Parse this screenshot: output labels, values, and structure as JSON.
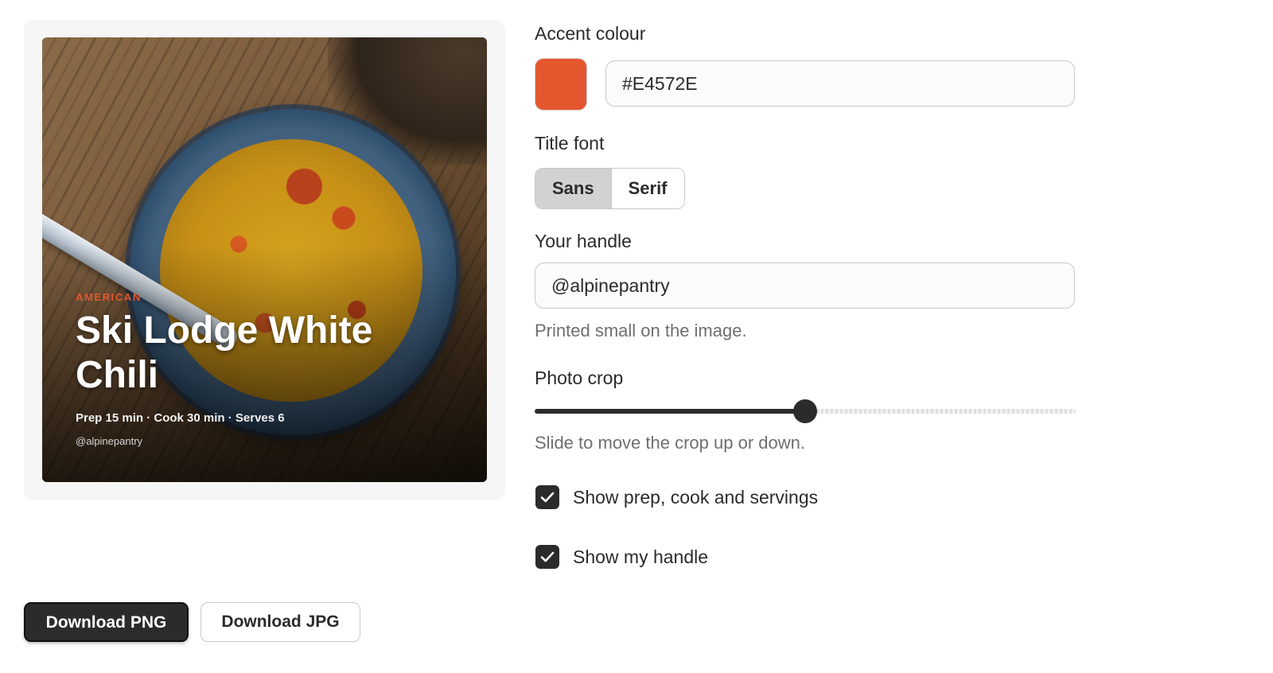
{
  "preview": {
    "category": "AMERICAN",
    "title": "Ski Lodge White Chili",
    "meta": "Prep 15 min · Cook 30 min · Serves 6",
    "handle": "@alpinepantry"
  },
  "accent": {
    "label": "Accent colour",
    "value": "#E4572E"
  },
  "title_font": {
    "label": "Title font",
    "options": [
      "Sans",
      "Serif"
    ],
    "selected": "Sans"
  },
  "handle_field": {
    "label": "Your handle",
    "value": "@alpinepantry",
    "hint": "Printed small on the image."
  },
  "photo_crop": {
    "label": "Photo crop",
    "value_fraction": 0.5,
    "hint": "Slide to move the crop up or down."
  },
  "options": {
    "show_meta": {
      "label": "Show prep, cook and servings",
      "checked": true
    },
    "show_handle": {
      "label": "Show my handle",
      "checked": true
    }
  },
  "actions": {
    "download_png": "Download PNG",
    "download_jpg": "Download JPG"
  }
}
